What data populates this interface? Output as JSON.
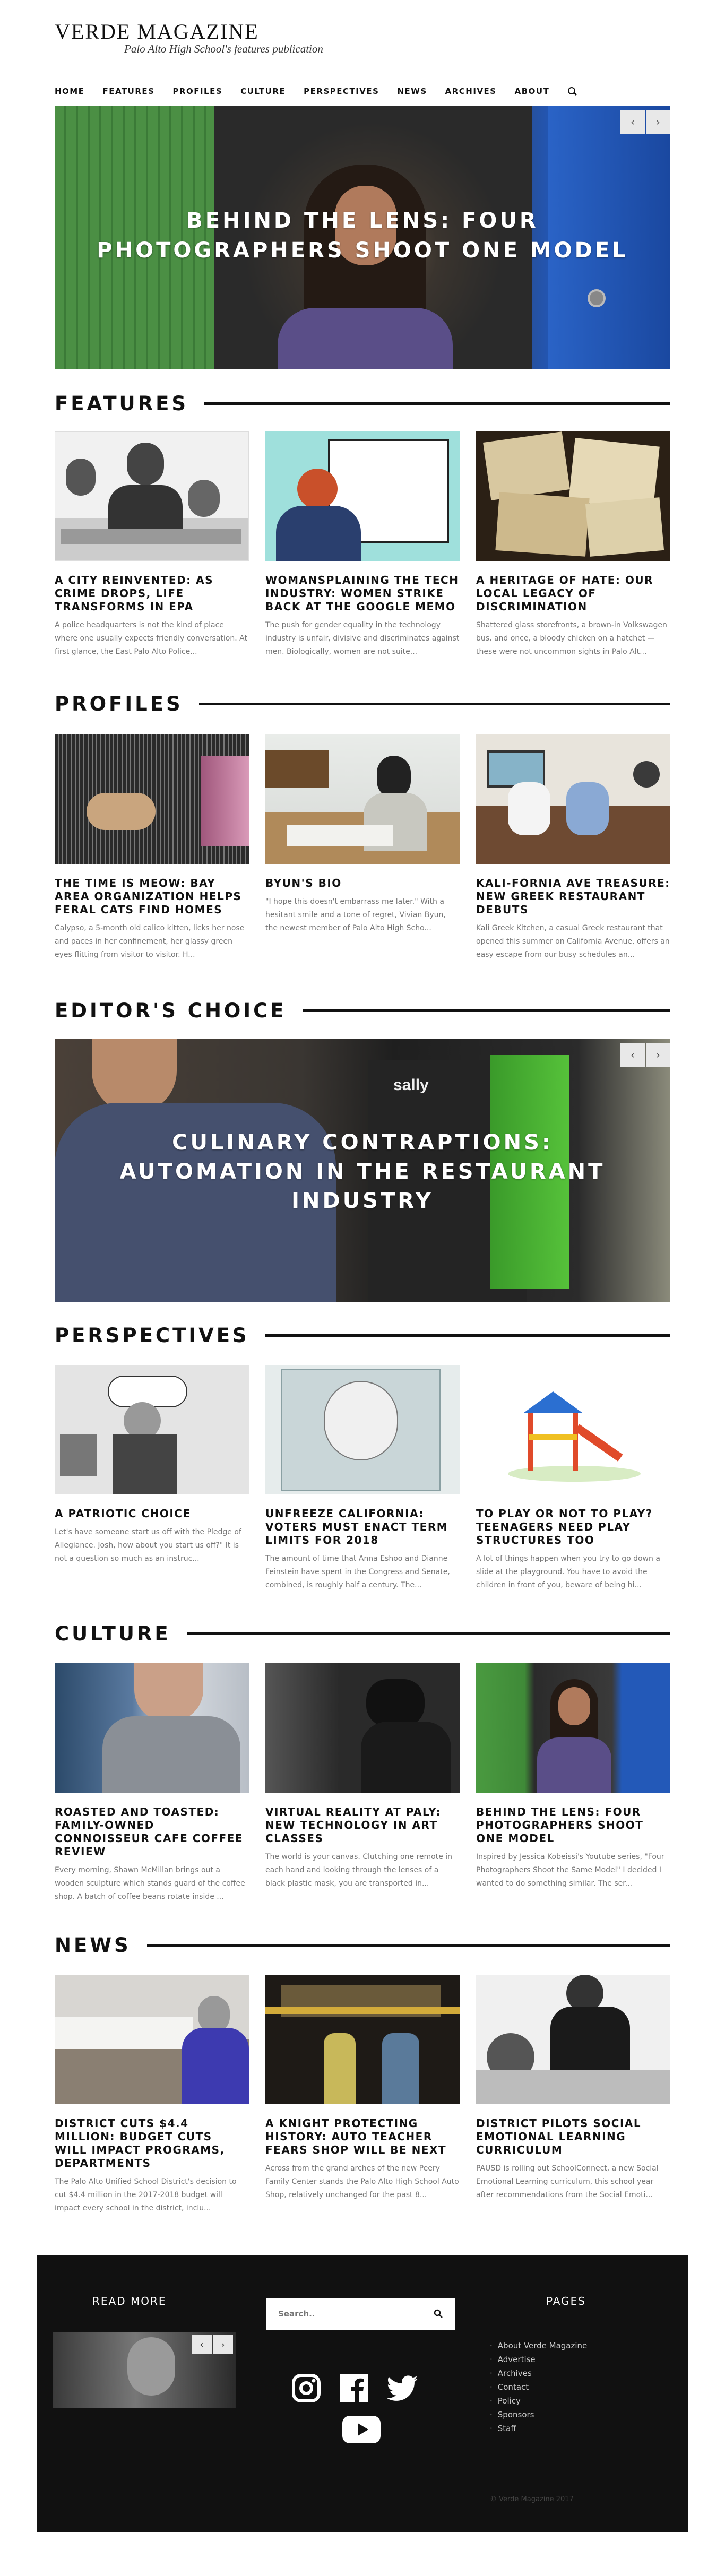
{
  "site": {
    "title": "VERDE MAGAZINE",
    "tagline": "Palo Alto High School's features publication"
  },
  "nav": [
    "HOME",
    "FEATURES",
    "PROFILES",
    "CULTURE",
    "PERSPECTIVES",
    "NEWS",
    "ARCHIVES",
    "ABOUT"
  ],
  "hero": {
    "title_line1": "BEHIND THE LENS: FOUR",
    "title_line2": "PHOTOGRAPHERS SHOOT ONE MODEL",
    "prev": "‹",
    "next": "›"
  },
  "features": {
    "heading": "FEATURES",
    "cards": [
      {
        "title": "A CITY REINVENTED: AS CRIME DROPS, LIFE TRANSFORMS IN EPA",
        "excerpt": "A police headquarters is not the kind of place where one usually expects friendly conversation. At first glance, the East Palo Alto Police..."
      },
      {
        "title": "WOMANSPLAINING THE TECH INDUSTRY: WOMEN STRIKE BACK AT THE GOOGLE MEMO",
        "excerpt": "The push for gender equality in the technology industry is unfair, divisive and discriminates against men. Biologically, women are not suite..."
      },
      {
        "title": "A HERITAGE OF HATE: OUR LOCAL LEGACY OF DISCRIMINATION",
        "excerpt": "Shattered glass storefronts, a brown-in Volkswagen bus, and once, a bloody chicken on a hatchet — these were not uncommon sights in Palo Alt..."
      }
    ]
  },
  "profiles": {
    "heading": "PROFILES",
    "cards": [
      {
        "title": "THE TIME IS MEOW: BAY AREA ORGANIZATION HELPS FERAL CATS FIND HOMES",
        "excerpt": "Calypso, a 5-month old calico kitten, licks her nose and paces in her confinement, her glassy green eyes flitting from visitor to visitor. H..."
      },
      {
        "title": "BYUN'S BIO",
        "excerpt": "\"I hope this doesn't embarrass me later.\" With a hesitant smile and a tone of regret, Vivian Byun, the newest member of Palo Alto High Scho..."
      },
      {
        "title": "KALI-FORNIA AVE TREASURE: NEW GREEK RESTAURANT DEBUTS",
        "excerpt": "Kali Greek Kitchen, a casual Greek restaurant that opened this summer on California Avenue, offers an easy escape from our busy schedules an..."
      }
    ]
  },
  "editors_choice": {
    "heading": "EDITOR'S CHOICE",
    "title_line1": "CULINARY CONTRAPTIONS:",
    "title_line2": "AUTOMATION IN THE RESTAURANT",
    "title_line3": "INDUSTRY",
    "sign": "sally",
    "prev": "‹",
    "next": "›"
  },
  "perspectives": {
    "heading": "PERSPECTIVES",
    "cards": [
      {
        "title": "A PATRIOTIC CHOICE",
        "excerpt": "Let's have someone start us off with the Pledge of Allegiance. Josh, how about you start us off?\" It is not a question so much as an instruc..."
      },
      {
        "title": "UNFREEZE CALIFORNIA: VOTERS MUST ENACT TERM LIMITS FOR 2018",
        "excerpt": "The amount of time that Anna Eshoo and Dianne Feinstein have spent in the Congress and Senate, combined, is roughly half a century. The..."
      },
      {
        "title": "TO PLAY OR NOT TO PLAY? TEENAGERS NEED PLAY STRUCTURES TOO",
        "excerpt": "A lot of things happen when you try to go down a slide at the playground. You have to avoid the children in front of you, beware of being hi..."
      }
    ]
  },
  "culture": {
    "heading": "CULTURE",
    "cards": [
      {
        "title": "ROASTED AND TOASTED: FAMILY-OWNED CONNOISSEUR CAFE COFFEE REVIEW",
        "excerpt": "Every morning, Shawn McMillan brings out a wooden sculpture which stands guard of the coffee shop. A batch of coffee beans rotate inside ..."
      },
      {
        "title": "VIRTUAL REALITY AT PALY: NEW TECHNOLOGY IN ART CLASSES",
        "excerpt": "The world is your canvas. Clutching one remote in each hand and looking through the lenses of a black plastic mask, you are transported in..."
      },
      {
        "title": "BEHIND THE LENS: FOUR PHOTOGRAPHERS SHOOT ONE MODEL",
        "excerpt": "Inspired by Jessica Kobeissi's Youtube series, \"Four Photographers Shoot the Same Model\" I decided I wanted to do something similar. The ser..."
      }
    ]
  },
  "news": {
    "heading": "NEWS",
    "cards": [
      {
        "title": "DISTRICT CUTS $4.4 MILLION: BUDGET CUTS WILL IMPACT PROGRAMS, DEPARTMENTS",
        "excerpt": "The Palo Alto Unified School District's decision to cut $4.4 million in the 2017-2018 budget will impact every school in the district, inclu..."
      },
      {
        "title": "A KNIGHT PROTECTING HISTORY: AUTO TEACHER FEARS SHOP WILL BE NEXT",
        "excerpt": "Across from the grand arches of the new Peery Family Center stands the Palo Alto High School Auto Shop, relatively unchanged for the past 8..."
      },
      {
        "title": "DISTRICT PILOTS SOCIAL EMOTIONAL LEARNING CURRICULUM",
        "excerpt": "PAUSD is rolling out SchoolConnect, a new Social Emotional Learning curriculum, this school year after recommendations from the Social Emoti..."
      }
    ]
  },
  "footer": {
    "read_more": "READ MORE",
    "search_placeholder": "Search..",
    "pages_heading": "PAGES",
    "pages": [
      "About Verde Magazine",
      "Advertise",
      "Archives",
      "Contact",
      "Policy",
      "Sponsors",
      "Staff"
    ],
    "copyright": "© Verde Magazine 2017",
    "prev": "‹",
    "next": "›"
  },
  "colors": {
    "accent": "#111111",
    "footer_bg": "#111111",
    "excerpt": "#777777"
  }
}
